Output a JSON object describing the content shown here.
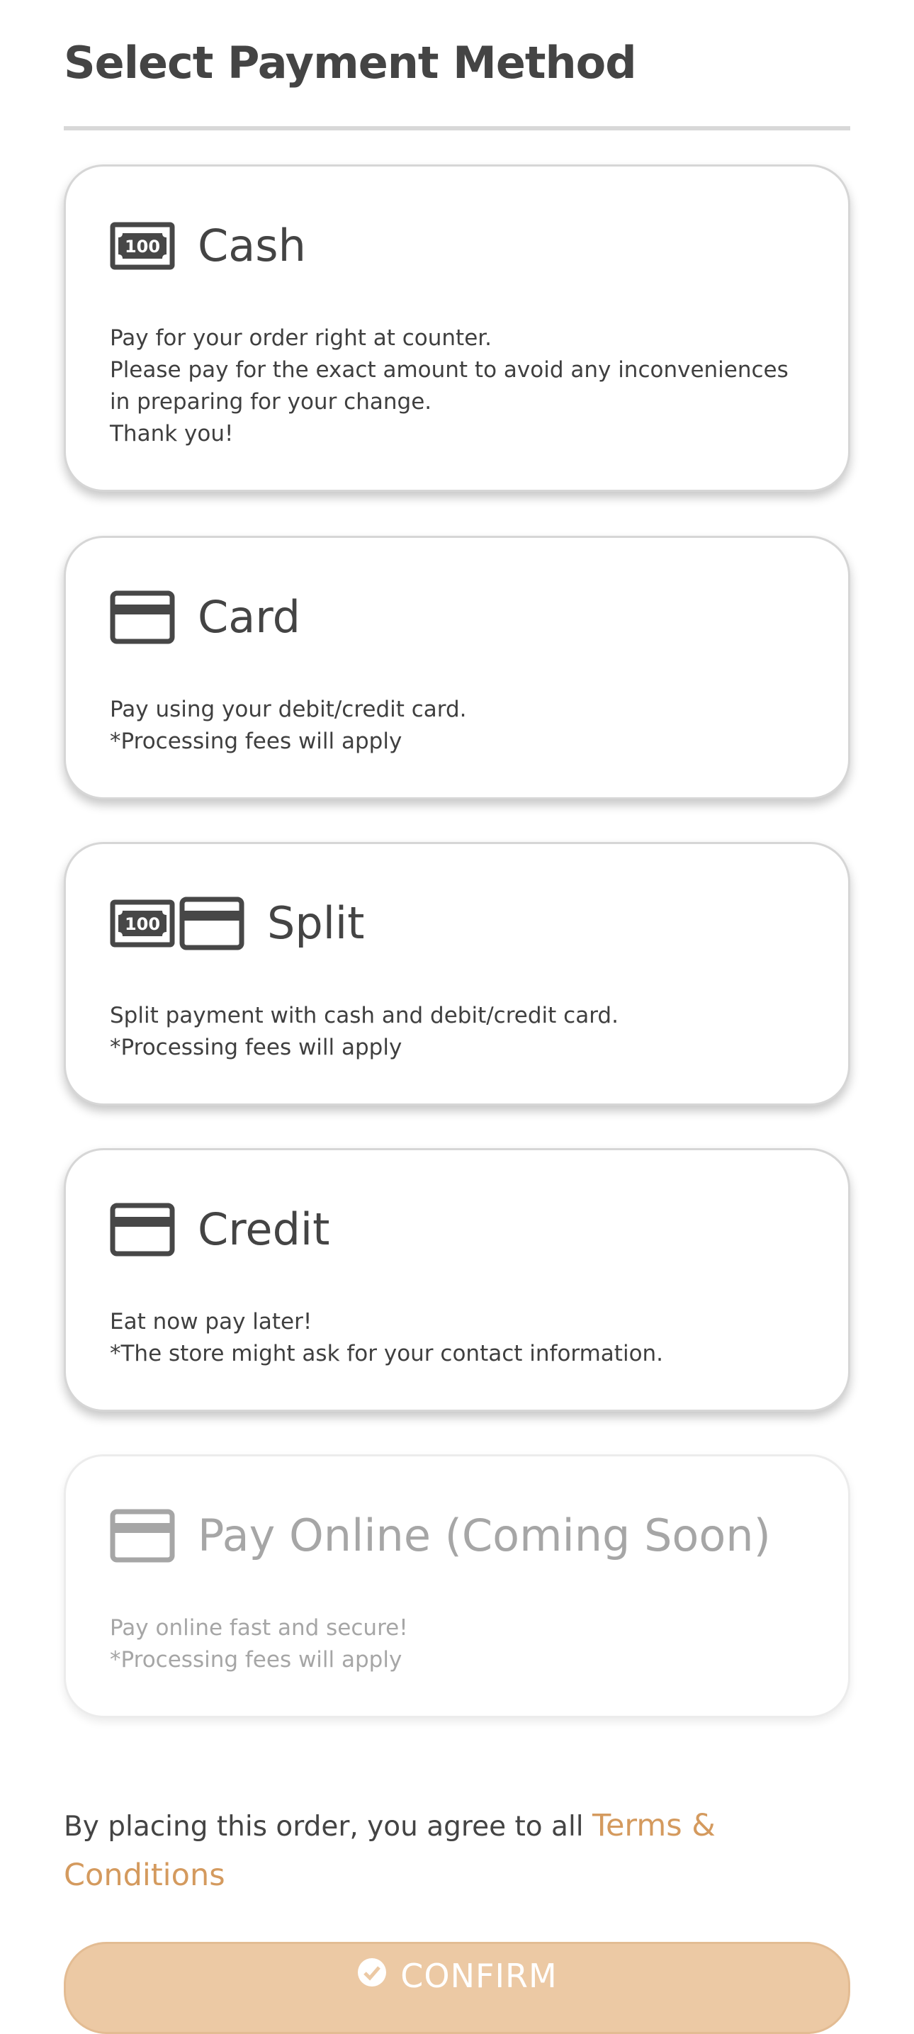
{
  "header": {
    "title": "Select Payment Method"
  },
  "methods": [
    {
      "id": "cash",
      "title": "Cash",
      "icons": [
        "cash-icon"
      ],
      "description": [
        "Pay for your order right at counter.",
        "Please pay for the exact amount to avoid any inconveniences in preparing for your change.",
        "Thank you!"
      ],
      "enabled": true
    },
    {
      "id": "card",
      "title": "Card",
      "icons": [
        "credit-card-icon"
      ],
      "description": [
        "Pay using your debit/credit card.",
        "*Processing fees will apply"
      ],
      "enabled": true
    },
    {
      "id": "split",
      "title": "Split",
      "icons": [
        "cash-icon",
        "credit-card-icon"
      ],
      "description": [
        "Split payment with cash and debit/credit card.",
        "*Processing fees will apply"
      ],
      "enabled": true
    },
    {
      "id": "credit",
      "title": "Credit",
      "icons": [
        "credit-card-icon"
      ],
      "description": [
        "Eat now pay later!",
        "*The store might ask for your contact information."
      ],
      "enabled": true
    },
    {
      "id": "pay-online",
      "title": "Pay Online (Coming Soon)",
      "icons": [
        "credit-card-icon"
      ],
      "description": [
        "Pay online fast and secure!",
        "*Processing fees will apply"
      ],
      "enabled": false
    }
  ],
  "icons": {
    "cash_label": "100"
  },
  "footer": {
    "agreement_text": "By placing this order, you agree to all ",
    "terms_link": "Terms & Conditions",
    "confirm_label": "CONFIRM"
  },
  "colors": {
    "text": "#444444",
    "accent": "#d49a5e",
    "confirm_bg": "#ecc9a4",
    "disabled": "#a6a6a6",
    "border": "#d6d6d6"
  }
}
